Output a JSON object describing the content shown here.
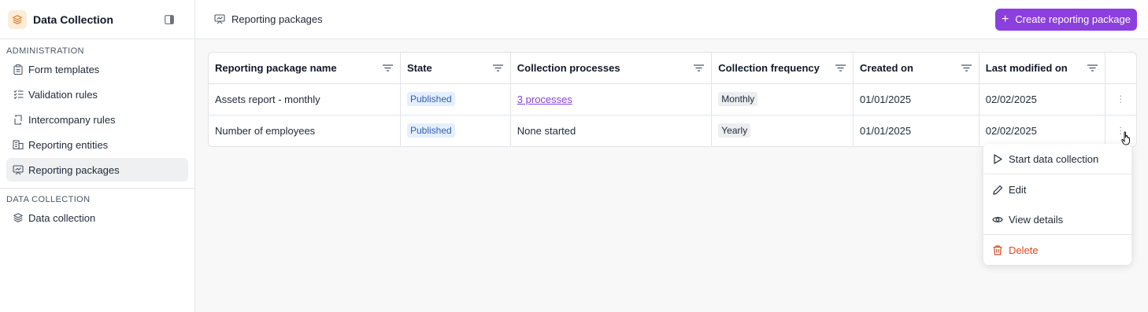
{
  "app": {
    "title": "Data Collection"
  },
  "sidebar": {
    "sections": [
      {
        "label": "ADMINISTRATION",
        "items": [
          {
            "label": "Form templates",
            "icon": "clipboard-icon"
          },
          {
            "label": "Validation rules",
            "icon": "checklist-icon"
          },
          {
            "label": "Intercompany rules",
            "icon": "intercompany-icon"
          },
          {
            "label": "Reporting entities",
            "icon": "building-icon"
          },
          {
            "label": "Reporting packages",
            "icon": "presentation-icon",
            "active": true
          }
        ]
      },
      {
        "label": "DATA COLLECTION",
        "items": [
          {
            "label": "Data collection",
            "icon": "layers-icon"
          }
        ]
      }
    ]
  },
  "header": {
    "breadcrumb": "Reporting packages",
    "create_button": "Create reporting package"
  },
  "table": {
    "columns": [
      "Reporting package name",
      "State",
      "Collection processes",
      "Collection frequency",
      "Created on",
      "Last modified on"
    ],
    "rows": [
      {
        "name": "Assets report - monthly",
        "state": "Published",
        "processes": "3 processes",
        "processes_is_link": true,
        "frequency": "Monthly",
        "created": "01/01/2025",
        "modified": "02/02/2025"
      },
      {
        "name": "Number of employees",
        "state": "Published",
        "processes": "None started",
        "processes_is_link": false,
        "frequency": "Yearly",
        "created": "01/01/2025",
        "modified": "02/02/2025"
      }
    ]
  },
  "context_menu": {
    "items": [
      {
        "label": "Start data collection",
        "icon": "play-icon"
      },
      {
        "label": "Edit",
        "icon": "pencil-icon"
      },
      {
        "label": "View details",
        "icon": "eye-icon"
      },
      {
        "label": "Delete",
        "icon": "trash-icon",
        "danger": true
      }
    ]
  },
  "colors": {
    "accent": "#8b3fdc",
    "danger": "#dc4a26",
    "badge_published_bg": "#e6efff"
  }
}
